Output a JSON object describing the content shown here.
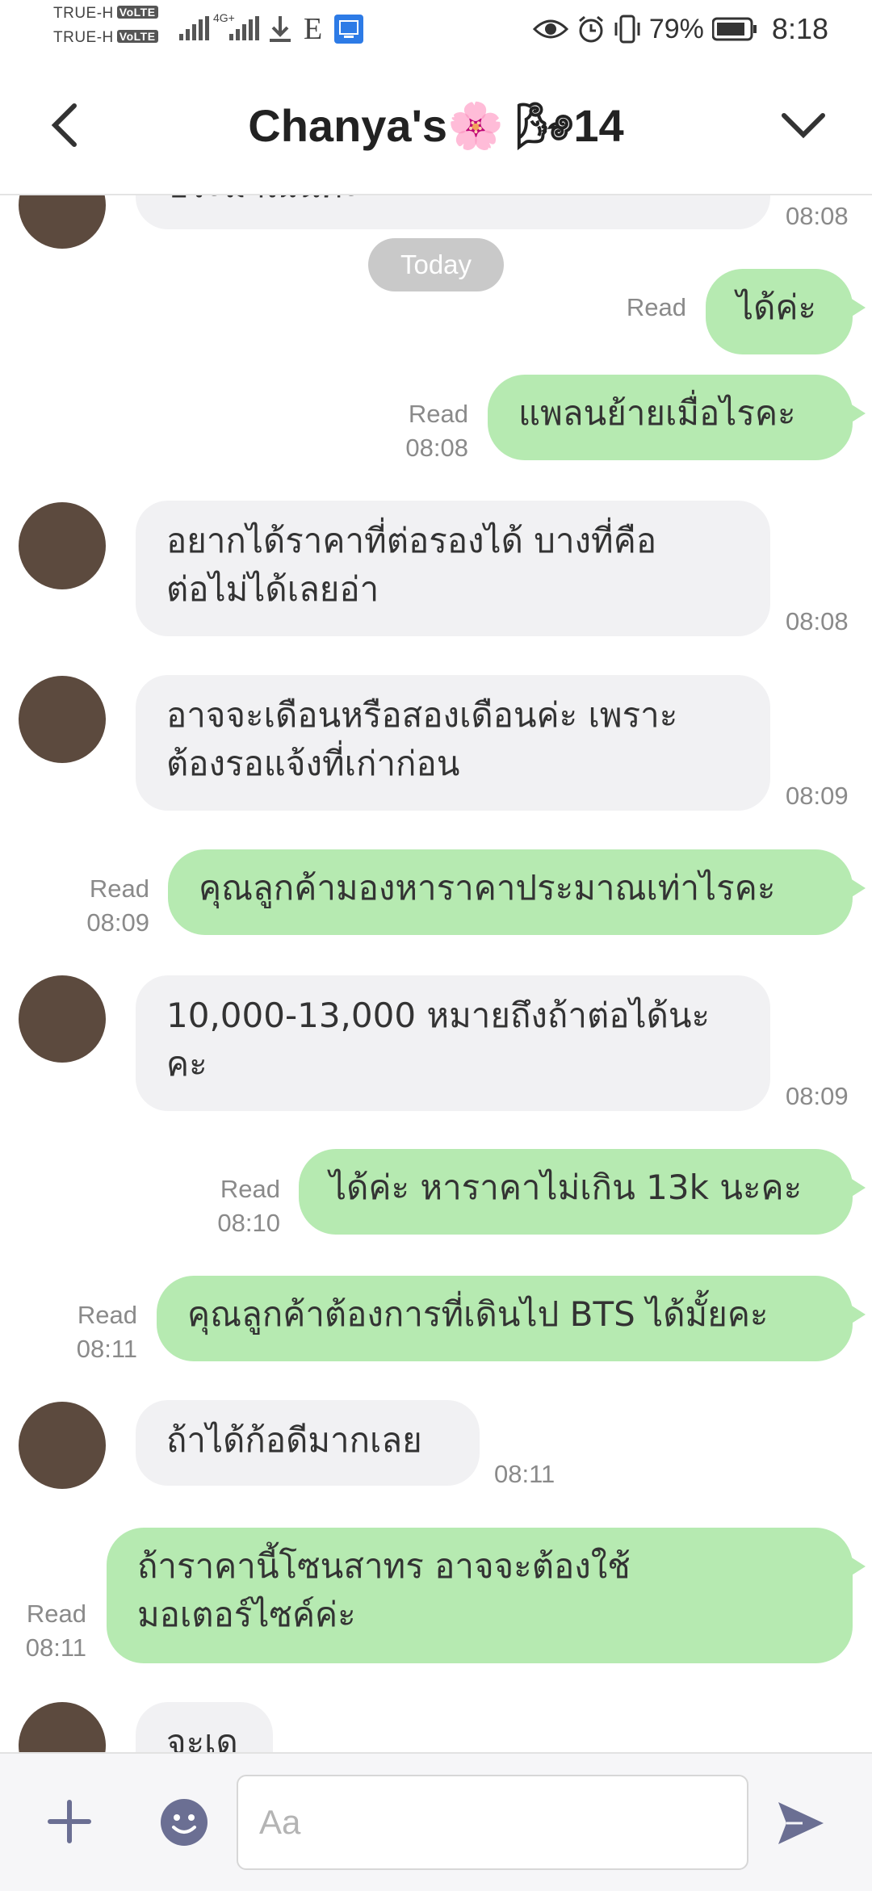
{
  "status_bar": {
    "carrier_1": "TRUE-H",
    "carrier_2": "TRUE-H",
    "volte": "VoLTE",
    "network": "4G+",
    "e_label": "E",
    "battery": "79%",
    "time": "8:18"
  },
  "header": {
    "title": "Chanya's🌸 🌬14"
  },
  "date_divider": "Today",
  "messages": [
    {
      "dir": "in",
      "text": "ประมาณนี้ค่ะ",
      "time": "08:08"
    },
    {
      "dir": "out",
      "text": "ได้ค่ะ",
      "read": "Read",
      "time": ""
    },
    {
      "dir": "out",
      "text": "แพลนย้ายเมื่อไรคะ",
      "read": "Read",
      "time": "08:08"
    },
    {
      "dir": "in",
      "line1": "อยากได้ราคาที่ต่อรองได้ บางที่คือ",
      "line2": "ต่อไม่ได้เลยอ่า",
      "time": "08:08"
    },
    {
      "dir": "in",
      "line1": "อาจจะเดือนหรือสองเดือนค่ะ เพราะ",
      "line2": "ต้องรอแจ้งที่เก่าก่อน",
      "time": "08:09"
    },
    {
      "dir": "out",
      "text": "คุณลูกค้ามองหาราคาประมาณเท่าไรคะ",
      "read": "Read",
      "time": "08:09"
    },
    {
      "dir": "in",
      "line1": "10,000-13,000 หมายถึงถ้าต่อได้นะ",
      "line2": "คะ",
      "time": "08:09"
    },
    {
      "dir": "out",
      "text": "ได้ค่ะ หาราคาไม่เกิน 13k นะคะ",
      "read": "Read",
      "time": "08:10"
    },
    {
      "dir": "out",
      "text": "คุณลูกค้าต้องการที่เดินไป BTS ได้มั้ยคะ",
      "read": "Read",
      "time": "08:11"
    },
    {
      "dir": "in",
      "text": "ถ้าได้ก้อดีมากเลย",
      "time": "08:11"
    },
    {
      "dir": "out",
      "line1": "ถ้าราคานี้โซนสาทร อาจจะต้องใช้",
      "line2": "มอเตอร์ไซค์ค่ะ",
      "read": "Read",
      "time": "08:11"
    },
    {
      "dir": "in",
      "text": "จะเด",
      "time": ""
    }
  ],
  "input": {
    "placeholder": "Aa"
  },
  "colors": {
    "outgoing_bubble": "#b6eab1",
    "incoming_bubble": "#f1f1f3",
    "accent": "#6b6f93"
  }
}
